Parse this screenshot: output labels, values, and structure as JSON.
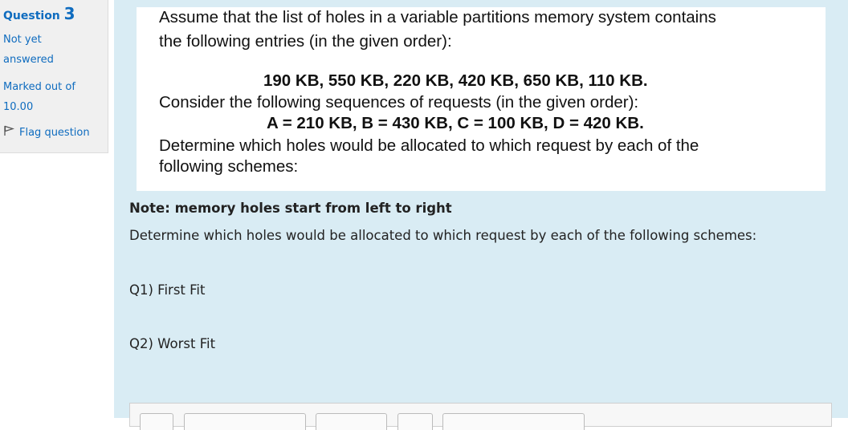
{
  "info": {
    "question_label": "Question",
    "question_number": "3",
    "state_line1": "Not yet",
    "state_line2": "answered",
    "grade_line1": "Marked out of",
    "grade_line2": "10.00",
    "flag_label": "Flag question"
  },
  "question_image": {
    "line1": "Assume that the list of holes in a variable partitions memory system contains",
    "line2": "the following entries (in the given order):",
    "holes": "190 KB, 550 KB, 220 KB, 420 KB, 650 KB, 110 KB.",
    "line3": "Consider the following sequences of requests (in the given order):",
    "requests": "A = 210 KB, B = 430 KB, C = 100 KB, D = 420 KB.",
    "line4": "Determine which holes would be allocated to which request by each of the",
    "line5": "following schemes:"
  },
  "note": "Note: memory holes start from left to right",
  "description": "Determine which holes would be allocated to which request by each of the following schemes:",
  "q1": "Q1) First Fit",
  "q2": "Q2) Worst Fit",
  "colors": {
    "link": "#0f6cbf",
    "content_bg": "#d9ecf4",
    "info_bg": "#f0f0f0"
  }
}
